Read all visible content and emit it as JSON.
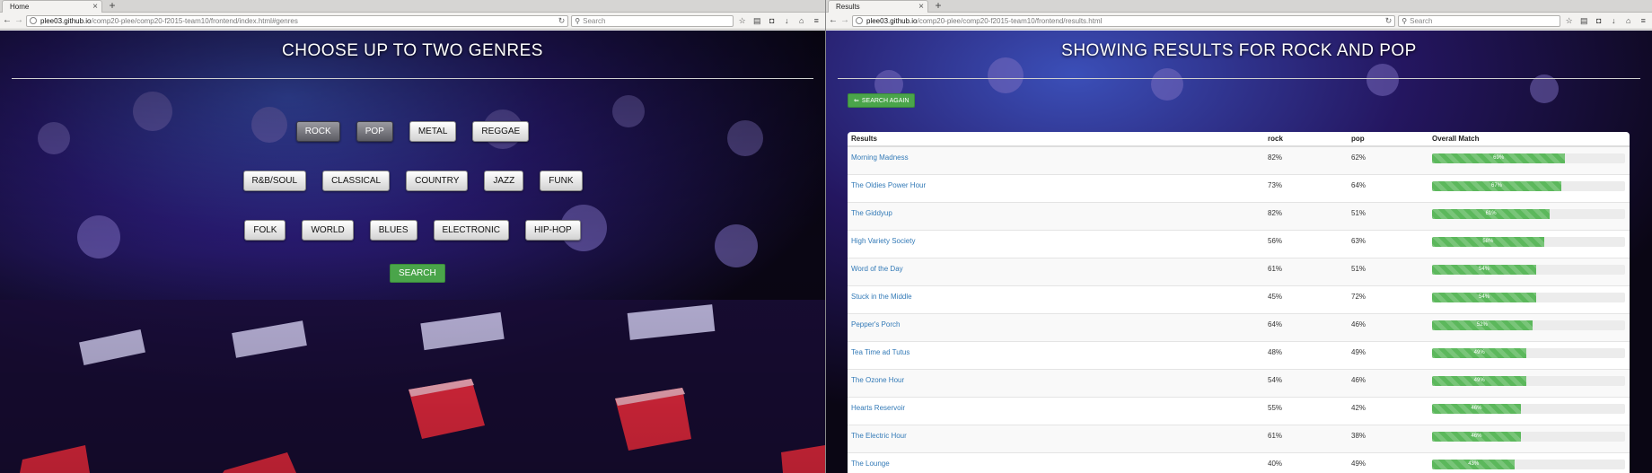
{
  "left_window": {
    "tab_title": "Home",
    "url_host": "plee03.github.io",
    "url_path": "/comp20-plee/comp20-f2015-team10/frontend/index.html#genres",
    "search_placeholder": "Search",
    "heading": "CHOOSE UP TO TWO GENRES",
    "genre_rows": [
      [
        "ROCK",
        "POP",
        "METAL",
        "REGGAE"
      ],
      [
        "R&B/SOUL",
        "CLASSICAL",
        "COUNTRY",
        "JAZZ",
        "FUNK"
      ],
      [
        "FOLK",
        "WORLD",
        "BLUES",
        "ELECTRONIC",
        "HIP-HOP"
      ]
    ],
    "selected_genres": [
      "ROCK",
      "POP"
    ],
    "search_button": "SEARCH"
  },
  "right_window": {
    "tab_title": "Results",
    "url_host": "plee03.github.io",
    "url_path": "/comp20-plee/comp20-f2015-team10/frontend/results.html",
    "search_placeholder": "Search",
    "heading": "SHOWING RESULTS FOR ROCK AND POP",
    "back_button": "SEARCH AGAIN",
    "table": {
      "headers": [
        "Results",
        "rock",
        "pop",
        "Overall Match"
      ],
      "rows": [
        {
          "title": "Morning Madness",
          "rock": "82%",
          "pop": "62%",
          "match": 69
        },
        {
          "title": "The Oldies Power Hour",
          "rock": "73%",
          "pop": "64%",
          "match": 67
        },
        {
          "title": "The Giddyup",
          "rock": "82%",
          "pop": "51%",
          "match": 61
        },
        {
          "title": "High Variety Society",
          "rock": "56%",
          "pop": "63%",
          "match": 58
        },
        {
          "title": "Word of the Day",
          "rock": "61%",
          "pop": "51%",
          "match": 54
        },
        {
          "title": "Stuck in the Middle",
          "rock": "45%",
          "pop": "72%",
          "match": 54
        },
        {
          "title": "Pepper's Porch",
          "rock": "64%",
          "pop": "46%",
          "match": 52
        },
        {
          "title": "Tea Time ad Tutus",
          "rock": "48%",
          "pop": "49%",
          "match": 49
        },
        {
          "title": "The Ozone Hour",
          "rock": "54%",
          "pop": "46%",
          "match": 49
        },
        {
          "title": "Hearts Reservoir",
          "rock": "55%",
          "pop": "42%",
          "match": 46
        },
        {
          "title": "The Electric Hour",
          "rock": "61%",
          "pop": "38%",
          "match": 46
        },
        {
          "title": "The Lounge",
          "rock": "40%",
          "pop": "49%",
          "match": 43
        }
      ]
    }
  },
  "icons": {
    "back": "back-arrow-icon",
    "forward": "forward-arrow-icon",
    "reload": "reload-icon",
    "bookmark": "star-icon",
    "library": "clipboard-icon",
    "pocket": "pocket-icon",
    "download": "download-icon",
    "home": "home-icon",
    "menu": "hamburger-menu-icon"
  },
  "colors": {
    "success_green": "#5cb85c",
    "link_blue": "#337ab7"
  }
}
